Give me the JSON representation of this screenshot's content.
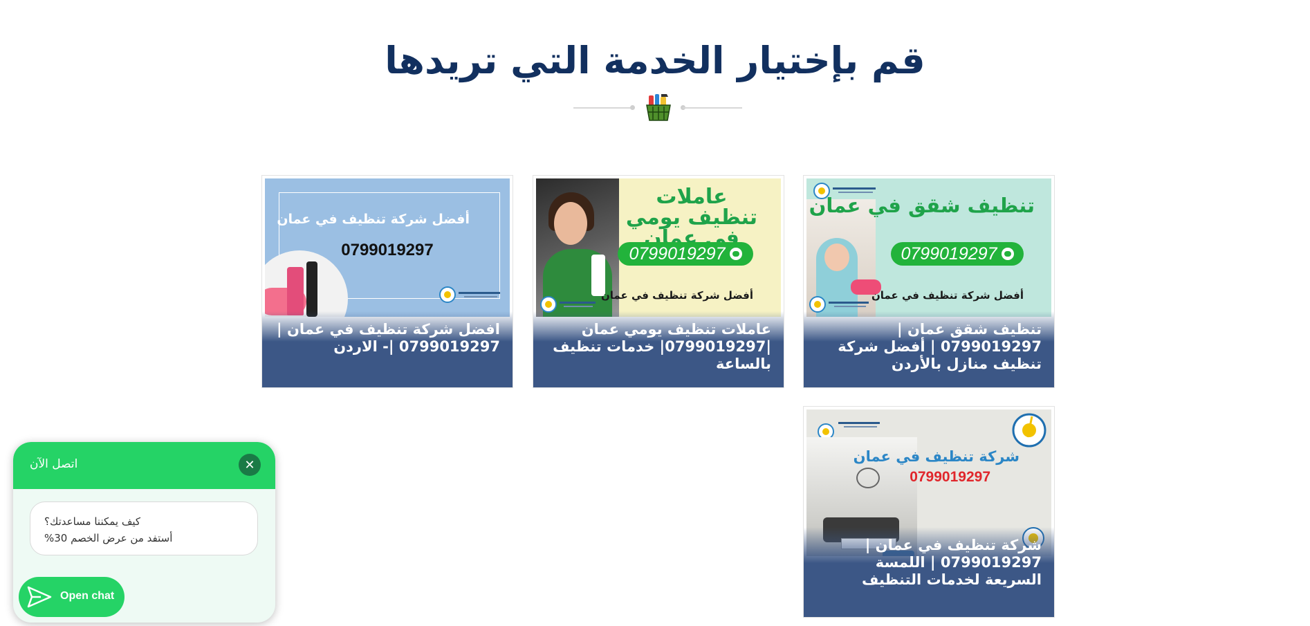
{
  "section": {
    "title": "قم بإختيار الخدمة التي تريدها",
    "divider_icon": "cleaning-basket-icon"
  },
  "cards": [
    {
      "caption": "تنظيف شقق عمان | 0799019297 | أفضل شركة تنظيف منازل بالأردن",
      "thumb": {
        "headline": "تنظيف شقق في عمان",
        "phone": "0799019297",
        "tagline": "أفضل شركة تنظيف في عمان"
      }
    },
    {
      "caption": "عاملات تنظيف يومي عمان |0799019297| خدمات تنظيف بالساعة",
      "thumb": {
        "headline": "عاملات تنظيف يومي في عمان",
        "phone": "0799019297",
        "tagline": "أفضل شركة تنظيف في عمان"
      }
    },
    {
      "caption": "افضل شركة تنظيف في عمان | 0799019297 |- الاردن",
      "thumb": {
        "headline": "أفضل شركة تنظيف في عمان",
        "phone": "0799019297"
      }
    },
    {
      "caption": "شركة تنظيف في عمان | 0799019297 | اللمسة السريعة لخدمات التنظيف",
      "thumb": {
        "headline": "شركة تنظيف في عمان",
        "phone": "0799019297"
      }
    }
  ],
  "chat": {
    "header_title": "اتصل الآن",
    "close_icon": "close-icon",
    "message_line1": "كيف يمكننا مساعدتك؟",
    "message_line2": "أستفد من عرض الخصم 30%",
    "open_button_label": "Open chat",
    "send_icon": "send-icon",
    "brand_color": "#25d366"
  },
  "colors": {
    "title": "#12305f",
    "caption_bg": "#3c5786",
    "pill_green": "#22b33b"
  }
}
